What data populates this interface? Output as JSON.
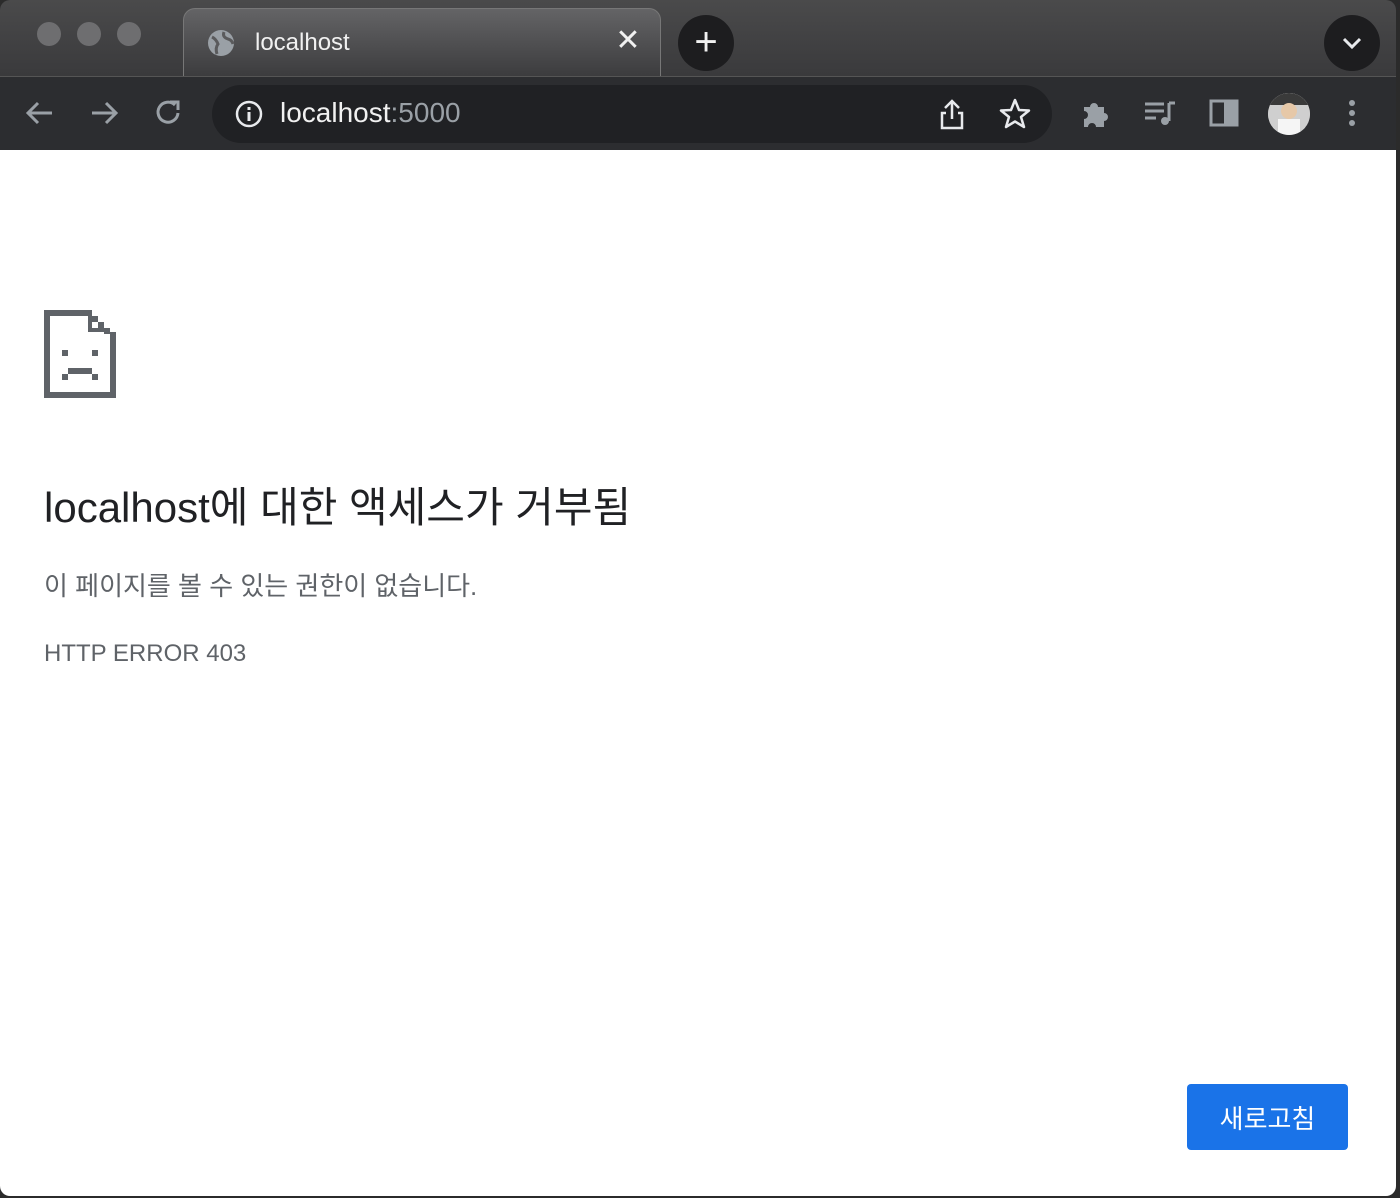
{
  "tab": {
    "title": "localhost",
    "close_glyph": "✕"
  },
  "newtab": {
    "glyph": "+"
  },
  "omnibox": {
    "host": "localhost",
    "port": ":5000"
  },
  "icons": {
    "tab": "globe-icon",
    "toolbar": [
      "back-arrow-icon",
      "forward-arrow-icon",
      "reload-icon",
      "info-icon",
      "share-icon",
      "star-icon",
      "puzzle-icon",
      "media-queue-icon",
      "side-panel-icon",
      "more-vert-icon"
    ],
    "error": "sad-page-icon"
  },
  "page": {
    "heading": "localhost에 대한 액세스가 거부됨",
    "description": "이 페이지를 볼 수 있는 권한이 없습니다.",
    "error_code": "HTTP ERROR 403",
    "reload_button": "새로고침"
  },
  "colors": {
    "accent": "#1a73e8",
    "toolbar": "#2c2d30",
    "page_bg": "#ffffff"
  }
}
